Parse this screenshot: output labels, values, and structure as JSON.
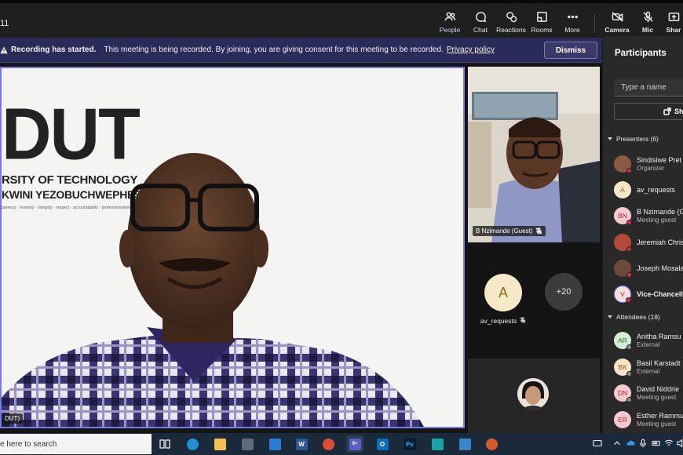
{
  "clock": "11",
  "toolbar": {
    "people": "People",
    "chat": "Chat",
    "reactions": "Reactions",
    "rooms": "Rooms",
    "more": "More",
    "camera": "Camera",
    "mic": "Mic",
    "share": "Shar"
  },
  "banner": {
    "title": "Recording has started.",
    "message": "This meeting is being recorded. By joining, you are giving consent for this meeting to be recorded.",
    "link": "Privacy policy",
    "dismiss": "Dismiss"
  },
  "main_video": {
    "logo_big": "DUT",
    "logo_line1": "RSITY OF TECHNOLOGY",
    "logo_line2": "KWINI YEZOBUCHWEPHESHE",
    "logo_values": "parency · honesty · integrity · respect · accountability · professionalism · commitment · compassion · excellence",
    "label": "DUT)"
  },
  "side_video": {
    "label": "B Nzimande (Guest)"
  },
  "tiles": {
    "av_initial": "A",
    "av_name": "av_requests",
    "more_count": "+20"
  },
  "panel": {
    "title": "Participants",
    "input_placeholder": "Type a name",
    "share_label": "Sh",
    "presenters_header": "Presenters (6)",
    "attendees_header": "Attendees (18)",
    "presenters": [
      {
        "initials": "",
        "name": "Sindisiwe Pret",
        "sub": "Organizer",
        "color": "#8a5a44"
      },
      {
        "initials": "A",
        "name": "av_requests",
        "sub": "",
        "color": "#f6e9c8"
      },
      {
        "initials": "BN",
        "name": "B Nzimande (G",
        "sub": "Meeting guest",
        "color": "#f4c9cf"
      },
      {
        "initials": "",
        "name": "Jeremiah Chris",
        "sub": "",
        "color": "#b34a3a"
      },
      {
        "initials": "",
        "name": "Joseph Mosala",
        "sub": "",
        "color": "#6b4a3a"
      },
      {
        "initials": "V",
        "name": "Vice-Chancell",
        "sub": "",
        "color": "#f6dede"
      }
    ],
    "attendees": [
      {
        "initials": "AR",
        "name": "Anitha Ramsu",
        "sub": "External",
        "color": "#d6ecd6"
      },
      {
        "initials": "BK",
        "name": "Basil Karstadt",
        "sub": "External",
        "color": "#f6e4c8"
      },
      {
        "initials": "DN",
        "name": "David Niddrie",
        "sub": "Meeting guest",
        "color": "#f4c9cf"
      },
      {
        "initials": "ER",
        "name": "Esther Rammu",
        "sub": "Meeting guest",
        "color": "#f4c9cf"
      }
    ]
  },
  "taskbar": {
    "search_text": "e here to search",
    "teams_badge": "9+"
  }
}
